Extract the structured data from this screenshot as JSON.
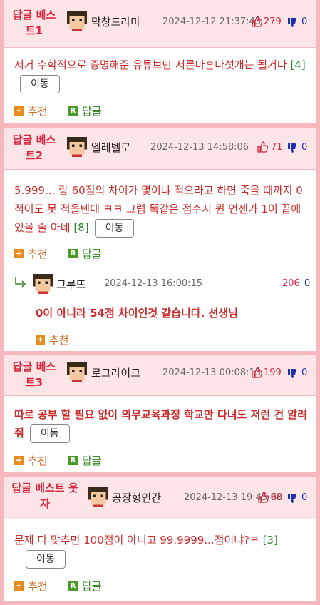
{
  "comments": [
    {
      "best": "답글 베스트1",
      "nick": "막창드라마",
      "date": "2024-12-12 21:37:43",
      "up": "279",
      "down": "0",
      "body": "저거 수학적으로 증명해준 유튜브만 서른마흔다섯개는 될거다",
      "count": "[4]",
      "move": "이동"
    },
    {
      "best": "답글 베스트2",
      "nick": "엘레벨로",
      "date": "2024-12-13 14:58:06",
      "up": "71",
      "down": "0",
      "body": "5.999... 랑 60점의 차이가 몇이냐 적으라고 하면 죽을 때까지 0 적어도 못 적을텐데 ㅋㅋ 그럼 똑같은 점수지 뭔 언젠가 1이 끝에 있을 줄 아네",
      "count": "[8]",
      "move": "이동"
    },
    {
      "best": "답글 베스트3",
      "nick": "로그라이크",
      "date": "2024-12-13 00:08:13",
      "up": "199",
      "down": "0",
      "body": "따로 공부 할 필요 없이 의무교육과정 학교만 다녀도 저런 건 알려줘",
      "count": "",
      "move": "이동"
    },
    {
      "best": "답글 베스트 웃자",
      "nick": "공장형인간",
      "date": "2024-12-13 19:45:08",
      "up": "60",
      "down": "0",
      "body": "문제 다 맞추면 100점이 아니고 99.9999...점이냐?ㅋ",
      "count": "[3]",
      "move": "이동"
    }
  ],
  "reply": {
    "nick": "그루뜨",
    "date": "2024-12-13 16:00:15",
    "up": "206",
    "down": "0",
    "body": "0이 아니라 54점 차이인것 같습니다. 선생님"
  },
  "actions": {
    "recommend": "추천",
    "reply": "답글"
  },
  "icons": {
    "plus": "+",
    "r": "R",
    "reply_arrow": "reply-arrow-icon"
  }
}
